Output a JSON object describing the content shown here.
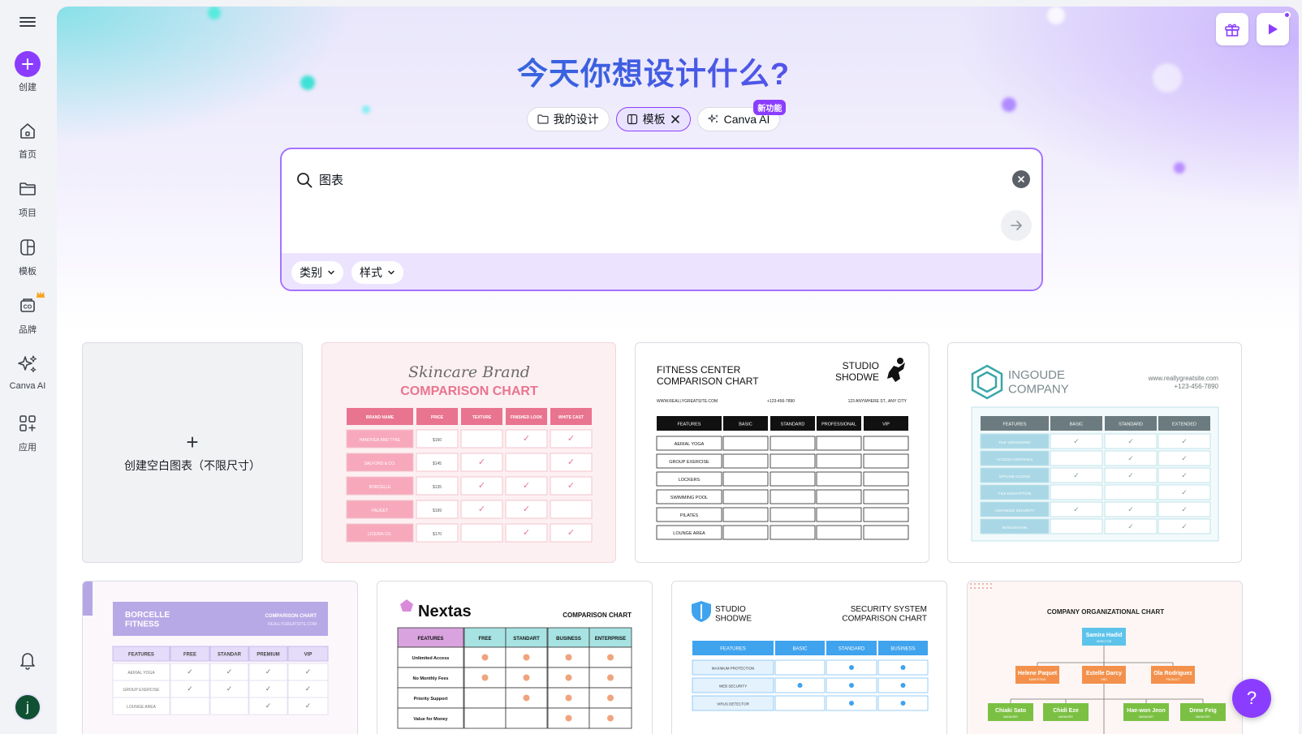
{
  "sidebar": {
    "items": [
      {
        "label": "创建",
        "icon": "plus-icon"
      },
      {
        "label": "首页",
        "icon": "home-icon"
      },
      {
        "label": "项目",
        "icon": "folder-icon"
      },
      {
        "label": "模板",
        "icon": "template-icon"
      },
      {
        "label": "品牌",
        "icon": "brand-icon"
      },
      {
        "label": "Canva AI",
        "icon": "sparkles-icon"
      },
      {
        "label": "应用",
        "icon": "apps-icon"
      }
    ],
    "avatar_initial": "j"
  },
  "hero": {
    "headline": "今天你想设计什么?",
    "chips": [
      {
        "label": "我的设计",
        "icon": "folder-icon"
      },
      {
        "label": "模板",
        "icon": "template-icon"
      },
      {
        "label": "Canva AI",
        "icon": "sparkles-icon",
        "badge": "新功能"
      }
    ]
  },
  "search": {
    "value": "图表",
    "filters": [
      "类别",
      "样式"
    ]
  },
  "blank_card": {
    "plus": "+",
    "label": "创建空白图表（不限尺寸）"
  },
  "templates": {
    "skincare": {
      "title_script": "Skincare Brand",
      "title": "COMPARISON CHART",
      "headers": [
        "BRAND NAME",
        "PRICE",
        "TEXTURE",
        "FINISHED LOOK",
        "WHITE CAST"
      ],
      "rows": [
        [
          "HANOVER AND TYKE",
          "$150",
          "",
          "✓",
          "✓"
        ],
        [
          "SALFORD & CO.",
          "$145",
          "✓",
          "",
          "✓"
        ],
        [
          "BORCELLE",
          "$135",
          "✓",
          "✓",
          "✓"
        ],
        [
          "FAUGET",
          "$199",
          "✓",
          "✓",
          ""
        ],
        [
          "LICERIA CO.",
          "$170",
          "",
          "✓",
          "✓"
        ]
      ]
    },
    "fitness": {
      "title": "FITNESS CENTER\nCOMPARISON CHART",
      "brand": "STUDIO\nSHODWE",
      "website": "WWW.REALLYGREATSITE.COM",
      "phone": "+123-456-7890",
      "address": "123 ANYWHERE ST., ANY CITY",
      "headers": [
        "FEATURES",
        "BASIC",
        "STANDARD",
        "PROFESSIONAL",
        "VIP"
      ],
      "rows": [
        "AERIAL YOGA",
        "GROUP EXERCISE",
        "LOCKERS",
        "SWIMMING POOL",
        "PILATES",
        "LOUNGE AREA"
      ]
    },
    "ingoude": {
      "brand": "INGOUDE\nCOMPANY",
      "website": "www.reallygreatsite.com",
      "phone": "+123-456-7890",
      "headers": [
        "FEATURES",
        "BASIC",
        "STANDARD",
        "EXTENDED"
      ],
      "rows": [
        [
          "FILE VERSIONING",
          "✓",
          "✓",
          "✓"
        ],
        [
          "ACCESS CONTROLS",
          "",
          "✓",
          "✓"
        ],
        [
          "OFFLINE ACCESS",
          "✓",
          "✓",
          "✓"
        ],
        [
          "FILE ENCRYPTION",
          "",
          "",
          "✓"
        ],
        [
          "ADVANCED SECURITY",
          "✓",
          "✓",
          "✓"
        ],
        [
          "INTEGRATION",
          "",
          "✓",
          "✓"
        ]
      ]
    },
    "borcelle": {
      "brand": "BORCELLE\nFITNESS",
      "subtitle": "COMPARISON CHART",
      "website": "REALLYGREATSITE.COM",
      "headers": [
        "FEATURES",
        "FREE",
        "STANDAR",
        "PREMIUM",
        "VIP"
      ],
      "rows": [
        [
          "AERIAL YOGA",
          "✓",
          "✓",
          "✓",
          "✓"
        ],
        [
          "GROUP EXERCISE",
          "✓",
          "✓",
          "✓",
          "✓"
        ],
        [
          "LOUNGE AREA",
          "",
          "",
          "✓",
          "✓"
        ]
      ]
    },
    "nextas": {
      "brand": "Nextas",
      "subtitle": "COMPARISON CHART",
      "headers": [
        "FEATURES",
        "FREE",
        "STANDART",
        "BUSINESS",
        "ENTERPRISE"
      ],
      "rows": [
        [
          "Unlimited Access",
          "●",
          "●",
          "●",
          "●"
        ],
        [
          "No Monthly Fees",
          "●",
          "●",
          "●",
          "●"
        ],
        [
          "Priority Support",
          "",
          "●",
          "●",
          "●"
        ],
        [
          "Value for Money",
          "",
          "",
          "●",
          "●"
        ]
      ]
    },
    "security": {
      "brand": "STUDIO\nSHODWE",
      "title": "SECURITY SYSTEM\nCOMPARISON CHART",
      "headers": [
        "FEATURES",
        "BASIC",
        "STANDARD",
        "BUSINESS"
      ],
      "rows": [
        [
          "MAXIMUM PROTECTION",
          "",
          "●",
          "●"
        ],
        [
          "WEB SECURITY",
          "●",
          "●",
          "●"
        ],
        [
          "VIRUS DETECTOR",
          "",
          "●",
          "●"
        ]
      ]
    },
    "org": {
      "title": "COMPANY ORGANIZATIONAL CHART",
      "top": {
        "name": "Samira Hadid",
        "role": "DIRECTOR"
      },
      "mid": [
        {
          "name": "Helene Paquet",
          "role": "MARKETING"
        },
        {
          "name": "Estelle Darcy",
          "role": "HRD"
        },
        {
          "name": "Ola Rodriguez",
          "role": "PRODUCT"
        }
      ],
      "bottom": [
        {
          "name": "Chiaki Sato",
          "role": "MANAGER"
        },
        {
          "name": "Chidi Eze",
          "role": "MANAGER"
        },
        {
          "name": "Hae-won Jeon",
          "role": "MANAGER"
        },
        {
          "name": "Drew Feig",
          "role": "MANAGER"
        }
      ]
    }
  },
  "help": {
    "label": "?"
  },
  "colors": {
    "accent": "#8b3dff",
    "skincare_pink": "#e9748f",
    "security_blue": "#3fa3ee",
    "ingoude_teal": "#3aa6a8"
  }
}
